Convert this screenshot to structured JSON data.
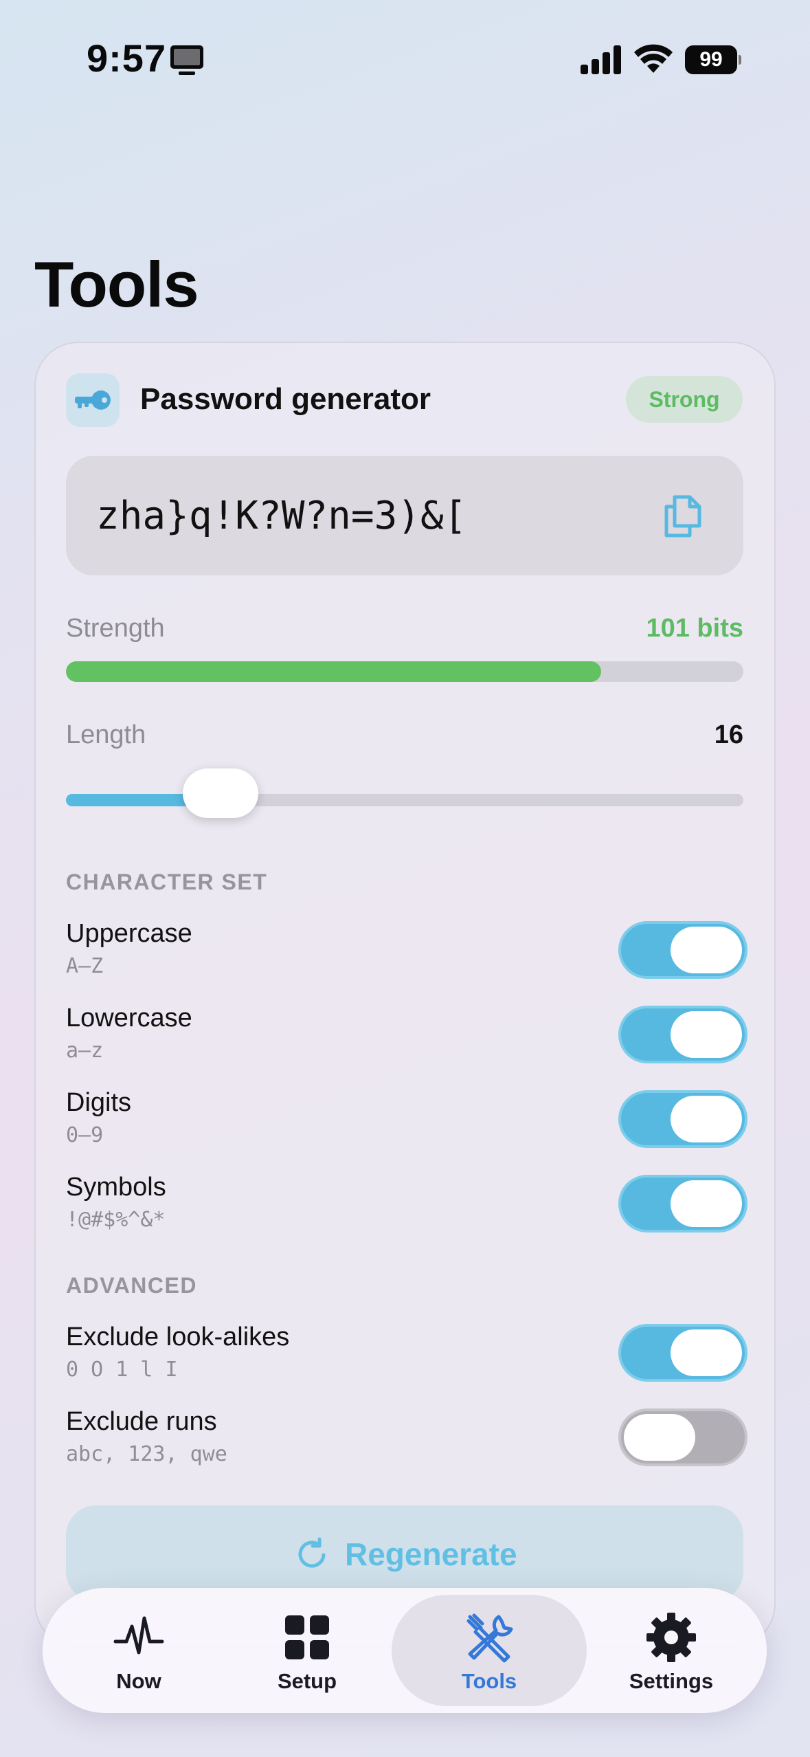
{
  "status_bar": {
    "time": "9:57",
    "battery": "99"
  },
  "page_title": "Tools",
  "generator": {
    "title": "Password generator",
    "strength_badge": "Strong",
    "password": "zha}q!K?W?n=3)&[",
    "strength_label": "Strength",
    "strength_bits": "101 bits",
    "strength_fraction": 0.79,
    "length_label": "Length",
    "length_value": "16",
    "length_slider_fraction": 0.19
  },
  "character_set": {
    "heading": "CHARACTER SET",
    "items": [
      {
        "title": "Uppercase",
        "subtitle": "A–Z",
        "enabled": true
      },
      {
        "title": "Lowercase",
        "subtitle": "a–z",
        "enabled": true
      },
      {
        "title": "Digits",
        "subtitle": "0–9",
        "enabled": true
      },
      {
        "title": "Symbols",
        "subtitle": "!@#$%^&*",
        "enabled": true
      }
    ]
  },
  "advanced": {
    "heading": "ADVANCED",
    "items": [
      {
        "title": "Exclude look-alikes",
        "subtitle": "0 O 1 l I",
        "enabled": true
      },
      {
        "title": "Exclude runs",
        "subtitle": "abc, 123, qwe",
        "enabled": false
      }
    ]
  },
  "regenerate_label": "Regenerate",
  "tabs": [
    {
      "label": "Now",
      "icon": "pulse-icon",
      "active": false
    },
    {
      "label": "Setup",
      "icon": "grid-icon",
      "active": false
    },
    {
      "label": "Tools",
      "icon": "tools-icon",
      "active": true
    },
    {
      "label": "Settings",
      "icon": "gear-icon",
      "active": false
    }
  ],
  "colors": {
    "accent": "#57b9e0",
    "strong": "#5dbb63",
    "active_tab": "#3478d8"
  }
}
